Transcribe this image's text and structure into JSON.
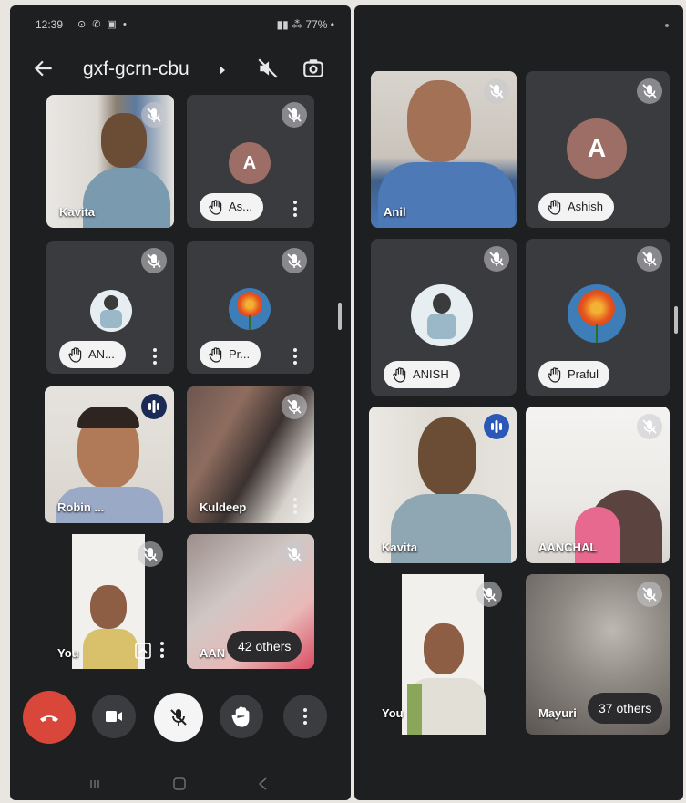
{
  "left_screen": {
    "status": {
      "time": "12:39",
      "battery": "77%"
    },
    "meeting_code": "gxf-gcrn-cbu",
    "tiles": [
      {
        "name": "Kavita"
      },
      {
        "pill": "As...",
        "avatar_letter": "A"
      },
      {
        "pill": "AN..."
      },
      {
        "pill": "Pr..."
      },
      {
        "name": "Robin ..."
      },
      {
        "name": "Kuldeep"
      },
      {
        "name": "You"
      },
      {
        "name": "AAN",
        "others": "42 others"
      }
    ]
  },
  "right_screen": {
    "tiles": [
      {
        "name": "Anil"
      },
      {
        "pill": "Ashish",
        "avatar_letter": "A"
      },
      {
        "pill": "ANISH"
      },
      {
        "pill": "Praful"
      },
      {
        "name": "Kavita"
      },
      {
        "name": "AANCHAL"
      },
      {
        "name": "You"
      },
      {
        "name": "Mayuri",
        "others": "37 others"
      }
    ]
  },
  "colors": {
    "end_call": "#d9463a",
    "speaking_outline": "#7ea7e6",
    "avatar_bg": "#9c6e66",
    "tile_bg": "#3a3b3e"
  },
  "icons": [
    "back-arrow-icon",
    "speaker-mute-icon",
    "switch-camera-icon",
    "mic-off-icon",
    "raised-hand-icon",
    "more-vert-icon",
    "end-call-icon",
    "camera-icon",
    "present-icon"
  ]
}
